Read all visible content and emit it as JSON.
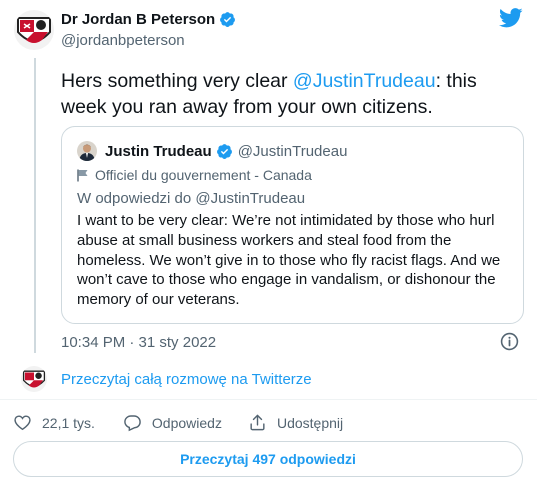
{
  "author": {
    "name": "Dr Jordan B Peterson",
    "handle": "@jordanbpeterson"
  },
  "tweet": {
    "text_prefix": "Hers something very clear ",
    "mention": "@JustinTrudeau",
    "text_suffix": ": this week you ran away from your own citizens.",
    "timestamp": "10:34 PM · 31 sty 2022"
  },
  "quoted": {
    "name": "Justin Trudeau",
    "handle": "@JustinTrudeau",
    "label": "Officiel du gouvernement - Canada",
    "reply_to": "W odpowiedzi do @JustinTrudeau",
    "text": "I want to be very clear: We’re not intimidated by those who hurl abuse at small business workers and steal food from the homeless. We won’t give in to those who fly racist flags. And we won’t cave to those who engage in vandalism, or dishonour the memory of our veterans."
  },
  "read_conversation": "Przeczytaj całą rozmowę na Twitterze",
  "actions": {
    "likes": "22,1 tys.",
    "reply": "Odpowiedz",
    "share": "Udostępnij"
  },
  "read_replies": "Przeczytaj 497 odpowiedzi",
  "colors": {
    "accent": "#1d9bf0",
    "text": "#0f1419",
    "secondary": "#536471",
    "border": "#cfd9de"
  },
  "icons": [
    "jordan-avatar",
    "verified-badge-icon",
    "twitter-bird-icon",
    "trudeau-avatar",
    "flag-icon",
    "info-icon",
    "heart-icon",
    "reply-icon",
    "share-icon"
  ]
}
